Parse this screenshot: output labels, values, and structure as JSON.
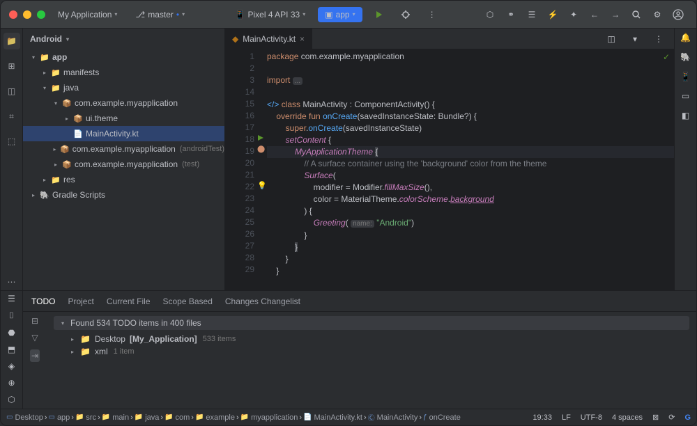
{
  "titlebar": {
    "project_name": "My Application",
    "branch": "master",
    "device": "Pixel 4 API 33",
    "run_config": "app"
  },
  "project": {
    "header": "Android",
    "tree": [
      {
        "indent": 10,
        "tw": "▾",
        "icon": "📁",
        "label": "app",
        "bold": true
      },
      {
        "indent": 26,
        "tw": "▸",
        "icon": "📁",
        "label": "manifests"
      },
      {
        "indent": 26,
        "tw": "▾",
        "icon": "📁",
        "label": "java"
      },
      {
        "indent": 42,
        "tw": "▾",
        "icon": "📦",
        "label": "com.example.myapplication"
      },
      {
        "indent": 58,
        "tw": "▸",
        "icon": "📦",
        "label": "ui.theme"
      },
      {
        "indent": 58,
        "tw": "",
        "icon": "📄",
        "label": "MainActivity.kt",
        "sel": true
      },
      {
        "indent": 42,
        "tw": "▸",
        "icon": "📦",
        "label": "com.example.myapplication",
        "suffix": "(androidTest)"
      },
      {
        "indent": 42,
        "tw": "▸",
        "icon": "📦",
        "label": "com.example.myapplication",
        "suffix": "(test)"
      },
      {
        "indent": 26,
        "tw": "▸",
        "icon": "📁",
        "label": "res"
      },
      {
        "indent": 10,
        "tw": "▸",
        "icon": "🐘",
        "label": "Gradle Scripts"
      }
    ]
  },
  "editor": {
    "tab_label": "MainActivity.kt",
    "lines": [
      1,
      2,
      3,
      14,
      15,
      16,
      17,
      18,
      19,
      20,
      21,
      22,
      23,
      24,
      25,
      26,
      27,
      28,
      29
    ]
  },
  "todo": {
    "tabs": [
      "TODO",
      "Project",
      "Current File",
      "Scope Based",
      "Changes Changelist"
    ],
    "active": 0,
    "found": "Found 534 TODO items in 400 files",
    "rows": [
      {
        "icon": "📁",
        "label": "Desktop",
        "bold": "[My_Application]",
        "count": "533 items"
      },
      {
        "icon": "📁",
        "label": "xml",
        "count": "1 item"
      }
    ]
  },
  "breadcrumbs": [
    "Desktop",
    "app",
    "src",
    "main",
    "java",
    "com",
    "example",
    "myapplication",
    "MainActivity.kt",
    "MainActivity",
    "onCreate"
  ],
  "status": {
    "pos": "19:33",
    "line_sep": "LF",
    "encoding": "UTF-8",
    "indent": "4 spaces"
  }
}
